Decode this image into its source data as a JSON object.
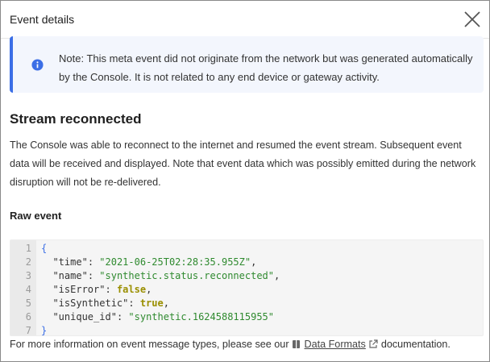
{
  "modal": {
    "title": "Event details"
  },
  "notice": {
    "icon": "info-icon",
    "text": "Note: This meta event did not originate from the network but was generated automatically by the Console. It is not related to any end device or gateway activity."
  },
  "event": {
    "title": "Stream reconnected",
    "description": "The Console was able to reconnect to the internet and resumed the event stream. Subsequent event data will be received and displayed. Note that event data which was possibly emitted during the network disruption will not be re-delivered."
  },
  "raw_event": {
    "label": "Raw event",
    "line_numbers": [
      "1",
      "2",
      "3",
      "4",
      "5",
      "6",
      "7"
    ],
    "open_brace": "{",
    "close_brace": "}",
    "fields": [
      {
        "key": "\"time\"",
        "value": "\"2021-06-25T02:28:35.955Z\"",
        "type": "string",
        "sep": ","
      },
      {
        "key": "\"name\"",
        "value": "\"synthetic.status.reconnected\"",
        "type": "string",
        "sep": ","
      },
      {
        "key": "\"isError\"",
        "value": "false",
        "type": "bool",
        "sep": ","
      },
      {
        "key": "\"isSynthetic\"",
        "value": "true",
        "type": "bool",
        "sep": ","
      },
      {
        "key": "\"unique_id\"",
        "value": "\"synthetic.1624588115955\"",
        "type": "string",
        "sep": ""
      }
    ]
  },
  "footer": {
    "prefix": "For more information on event message types, please see our",
    "link_label": "Data Formats",
    "suffix": "documentation."
  },
  "colors": {
    "accent": "#3b6ee6",
    "string": "#2f8a2f",
    "boolean": "#9a8f00"
  }
}
